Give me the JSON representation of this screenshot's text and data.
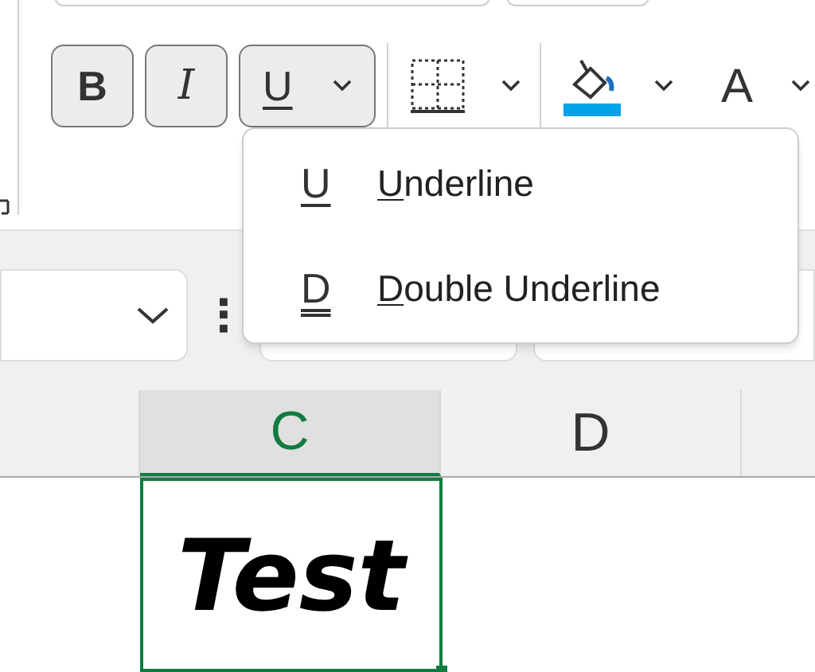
{
  "toolbar": {
    "buttons": [
      {
        "kind": "bold",
        "label": "B"
      },
      {
        "kind": "italic",
        "label": "I"
      },
      {
        "kind": "underline",
        "label": "U"
      }
    ],
    "font_color_label": "A"
  },
  "underline_menu": {
    "items": [
      {
        "kind": "single",
        "icon": "U",
        "label": "Underline"
      },
      {
        "kind": "double",
        "icon": "D",
        "label": "Double Underline"
      }
    ]
  },
  "column_headers": [
    {
      "selected": false
    },
    {
      "label": "C",
      "selected": true
    },
    {
      "label": "D",
      "selected": false
    }
  ],
  "cell": {
    "value": "Test",
    "selected": true
  }
}
